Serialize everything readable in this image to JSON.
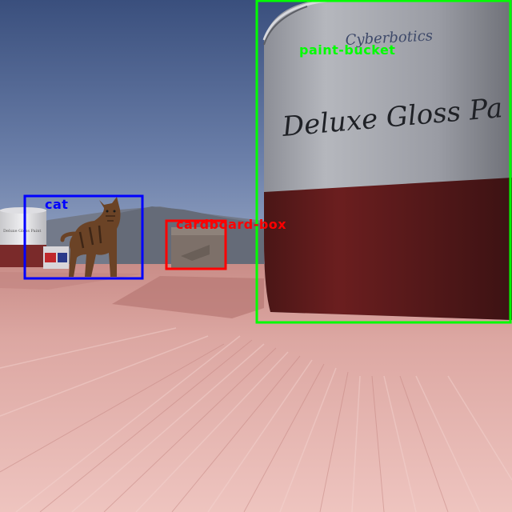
{
  "detections": [
    {
      "label": "paint-bucket",
      "color": "#00ff00"
    },
    {
      "label": "cat",
      "color": "#0000ff"
    },
    {
      "label": "cardboard-box",
      "color": "#ff0000"
    }
  ],
  "bucket": {
    "brand": "Cyberbotics",
    "product": "Deluxe Gloss Pa"
  },
  "small_bucket": {
    "product": "Deluxe Gloss Paint"
  }
}
